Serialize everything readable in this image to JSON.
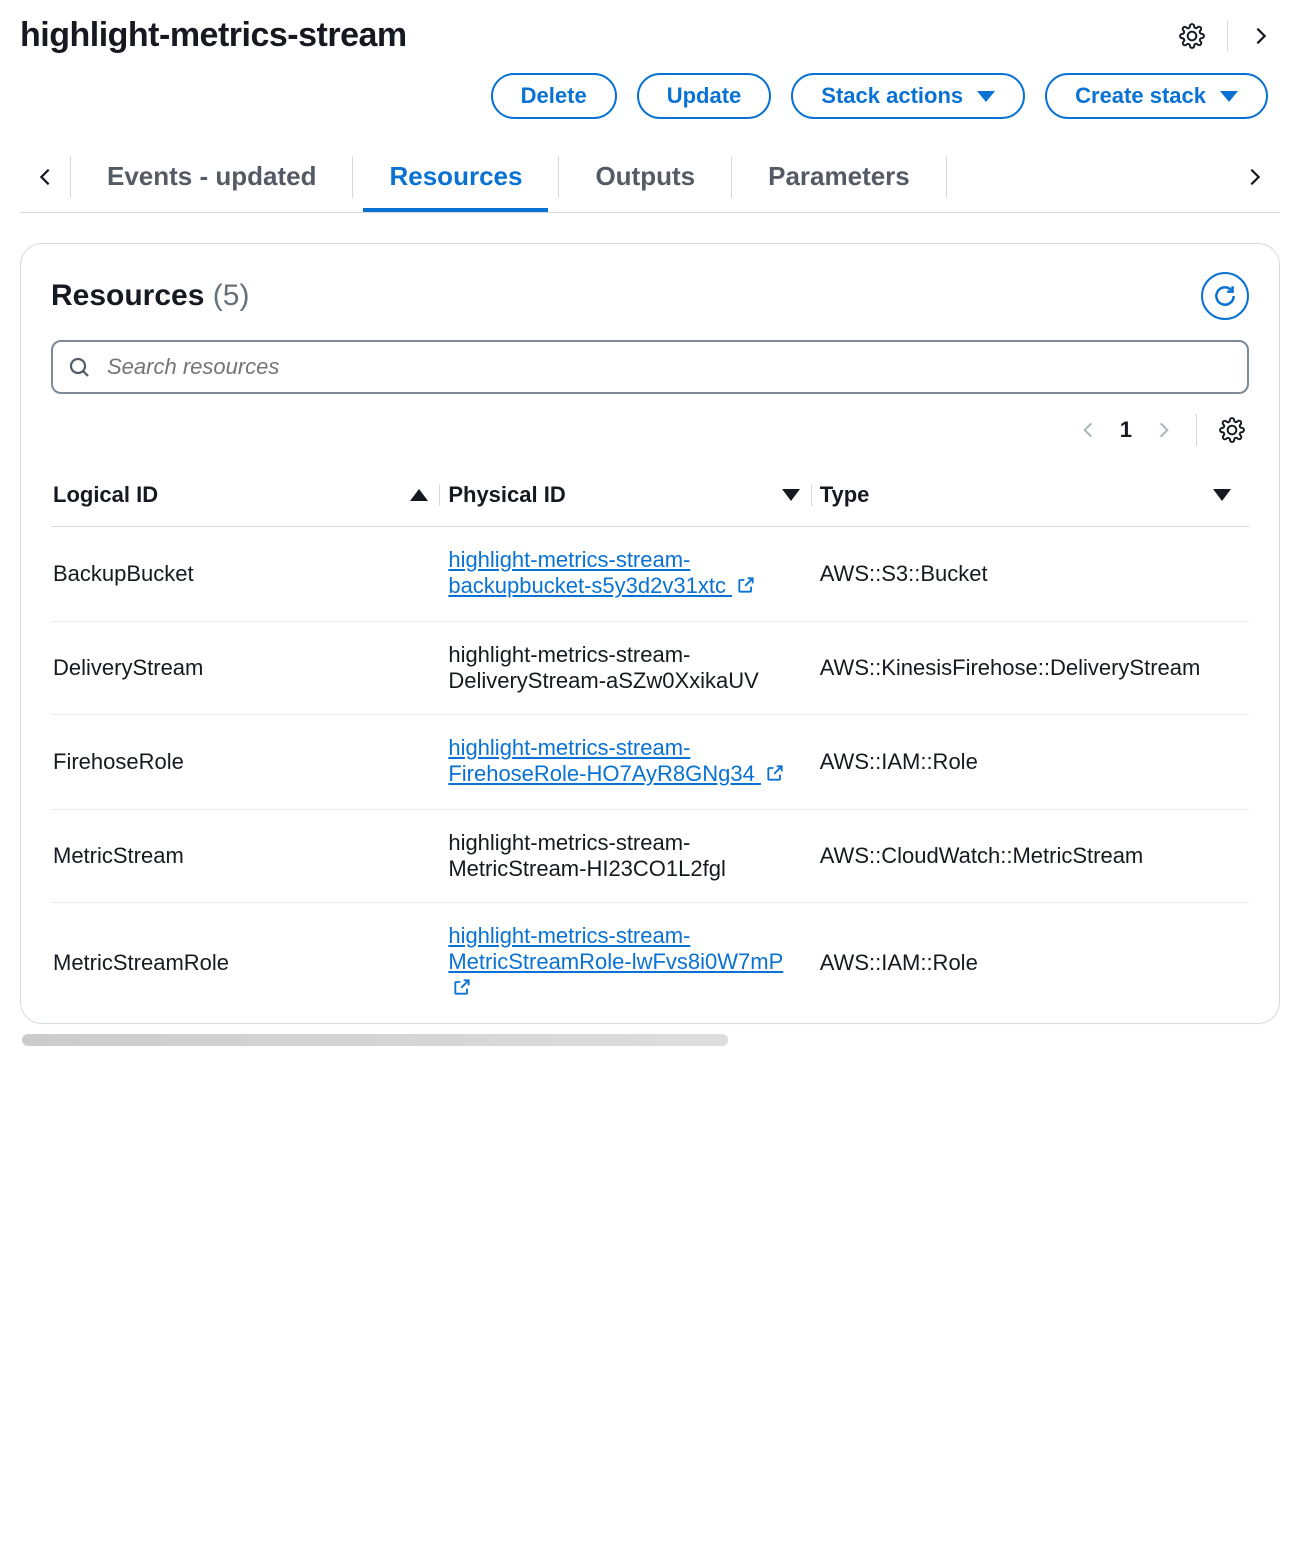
{
  "header": {
    "title": "highlight-metrics-stream"
  },
  "actions": {
    "delete": "Delete",
    "update": "Update",
    "stack_actions": "Stack actions",
    "create_stack": "Create stack"
  },
  "tabs": {
    "events": "Events - updated",
    "resources": "Resources",
    "outputs": "Outputs",
    "parameters": "Parameters"
  },
  "panel": {
    "title": "Resources",
    "count": "(5)",
    "search_placeholder": "Search resources",
    "page": "1"
  },
  "columns": {
    "logical_id": "Logical ID",
    "physical_id": "Physical ID",
    "type": "Type"
  },
  "rows": [
    {
      "logical_id": "BackupBucket",
      "physical_id": "highlight-metrics-stream-backupbucket-s5y3d2v31xtc",
      "is_link": true,
      "type": "AWS::S3::Bucket"
    },
    {
      "logical_id": "DeliveryStream",
      "physical_id": "highlight-metrics-stream-DeliveryStream-aSZw0XxikaUV",
      "is_link": false,
      "type": "AWS::KinesisFirehose::DeliveryStream"
    },
    {
      "logical_id": "FirehoseRole",
      "physical_id": "highlight-metrics-stream-FirehoseRole-HO7AyR8GNg34",
      "is_link": true,
      "type": "AWS::IAM::Role"
    },
    {
      "logical_id": "MetricStream",
      "physical_id": "highlight-metrics-stream-MetricStream-HI23CO1L2fgl",
      "is_link": false,
      "type": "AWS::CloudWatch::MetricStream"
    },
    {
      "logical_id": "MetricStreamRole",
      "physical_id": "highlight-metrics-stream-MetricStreamRole-lwFvs8i0W7mP",
      "is_link": true,
      "type": "AWS::IAM::Role"
    }
  ]
}
